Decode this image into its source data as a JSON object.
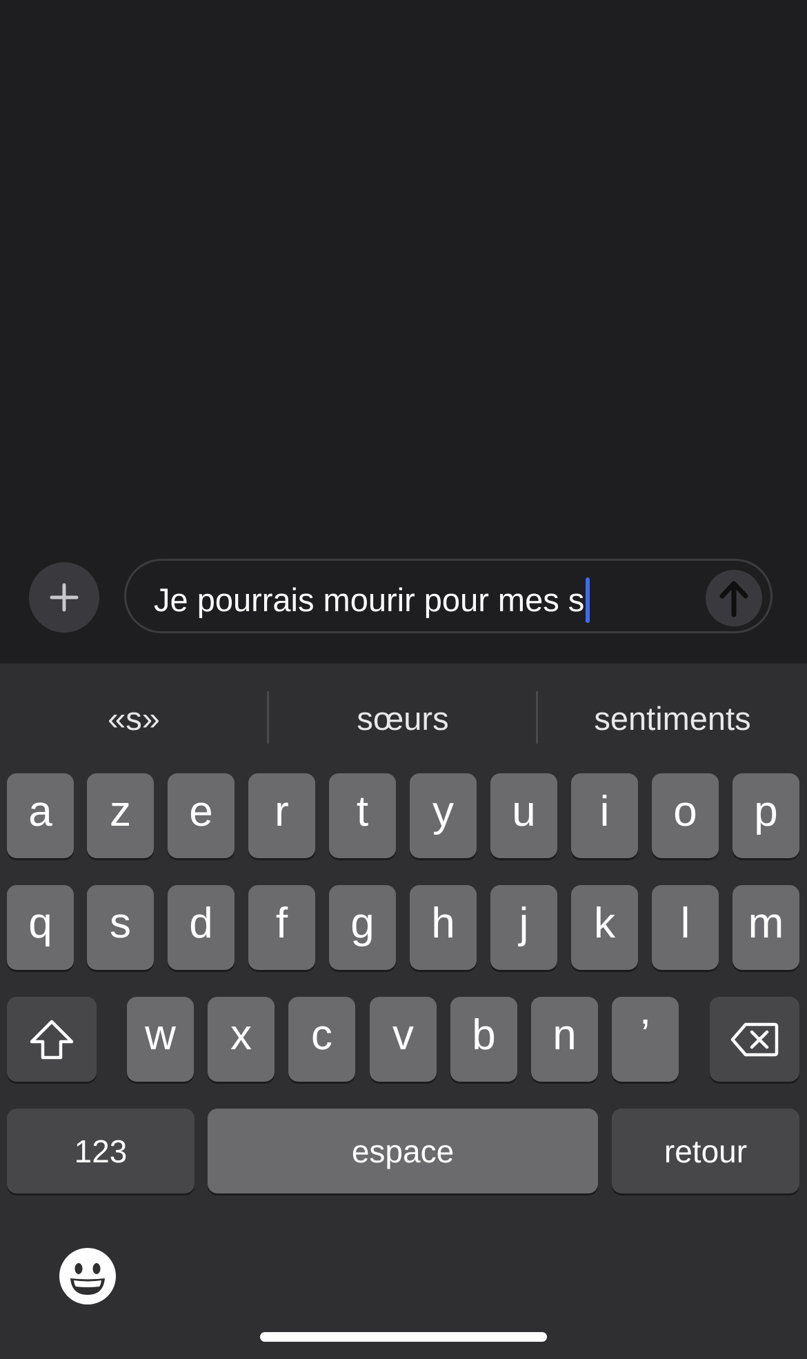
{
  "compose": {
    "message_text": "Je pourrais mourir pour mes s",
    "plus_icon": "plus-icon",
    "send_icon": "arrow-up-icon"
  },
  "keyboard": {
    "suggestions": [
      "«s»",
      "sœurs",
      "sentiments"
    ],
    "row1": [
      "a",
      "z",
      "e",
      "r",
      "t",
      "y",
      "u",
      "i",
      "o",
      "p"
    ],
    "row2": [
      "q",
      "s",
      "d",
      "f",
      "g",
      "h",
      "j",
      "k",
      "l",
      "m"
    ],
    "row3": [
      "w",
      "x",
      "c",
      "v",
      "b",
      "n",
      "’"
    ],
    "numbers_label": "123",
    "space_label": "espace",
    "return_label": "retour",
    "shift_icon": "shift-icon",
    "delete_icon": "delete-icon",
    "emoji_icon": "emoji-icon"
  },
  "colors": {
    "background": "#1e1e20",
    "keyboard_bg": "#2f2f31",
    "key": "#6b6b6d",
    "key_dark": "#474749",
    "caret": "#3d6cf0"
  }
}
